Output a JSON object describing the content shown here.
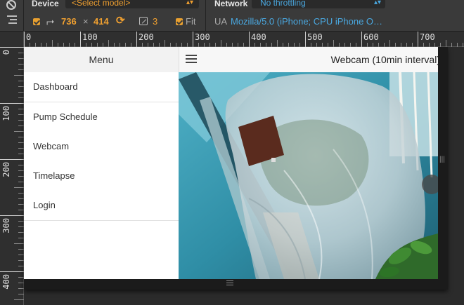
{
  "devtools": {
    "device_label": "Device",
    "model_select": "<Select model>",
    "width": "736",
    "times": "×",
    "height": "414",
    "scale": "3",
    "fit_label": "Fit",
    "network_label": "Network",
    "throttling": "No throttling",
    "ua_label": "UA",
    "ua_value": "Mozilla/5.0 (iPhone; CPU iPhone O…"
  },
  "rulers": {
    "top": [
      "0",
      "100",
      "200",
      "300",
      "400",
      "500",
      "600",
      "700"
    ],
    "left": [
      "0",
      "100",
      "200",
      "300",
      "400"
    ]
  },
  "app": {
    "menu_title": "Menu",
    "menu_items": [
      {
        "label": "Dashboard"
      },
      {
        "label": "Pump Schedule"
      },
      {
        "label": "Webcam"
      },
      {
        "label": "Timelapse"
      },
      {
        "label": "Login"
      }
    ],
    "content_title": "Webcam (10min interval)"
  }
}
